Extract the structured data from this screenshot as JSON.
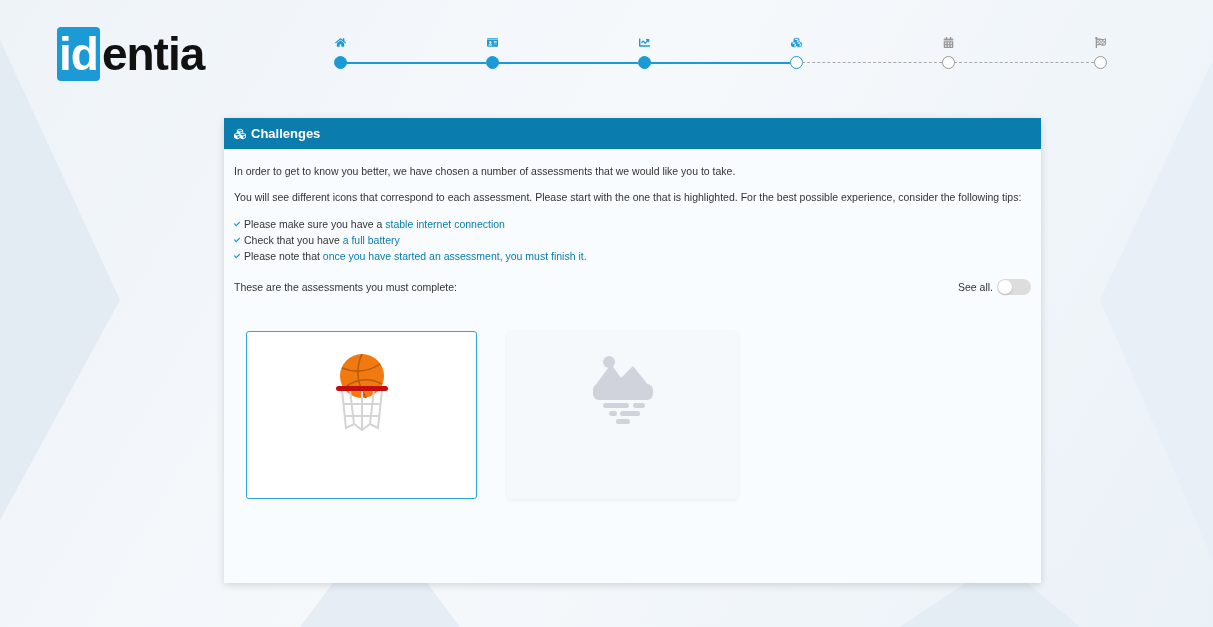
{
  "logo": {
    "mark": "id",
    "rest": "entia"
  },
  "steps": [
    {
      "kind": "done"
    },
    {
      "kind": "done"
    },
    {
      "kind": "done"
    },
    {
      "kind": "current"
    },
    {
      "kind": "pending"
    },
    {
      "kind": "pending"
    }
  ],
  "panel": {
    "title": "Challenges",
    "paragraphs": [
      "In order to get to know you better, we have chosen a number of assessments that we would like you to take.",
      "You will see different icons that correspond to each assessment. Please start with the one that is highlighted. For the best possible experience, consider the following tips:"
    ],
    "tips": [
      {
        "text": "Please make sure you have a ",
        "link": "stable internet connection"
      },
      {
        "text": "Check that you have ",
        "link": "a full battery"
      },
      {
        "text": "Please note that ",
        "link": "once you have started an assessment, you must finish it."
      }
    ],
    "assessments_label": "These are the assessments you must complete:",
    "see_all": {
      "label": "See all.",
      "on": false
    },
    "assessments": [
      {
        "kind": "basketball",
        "selected": true,
        "disabled": false
      },
      {
        "kind": "landscape",
        "selected": false,
        "disabled": true
      }
    ]
  }
}
